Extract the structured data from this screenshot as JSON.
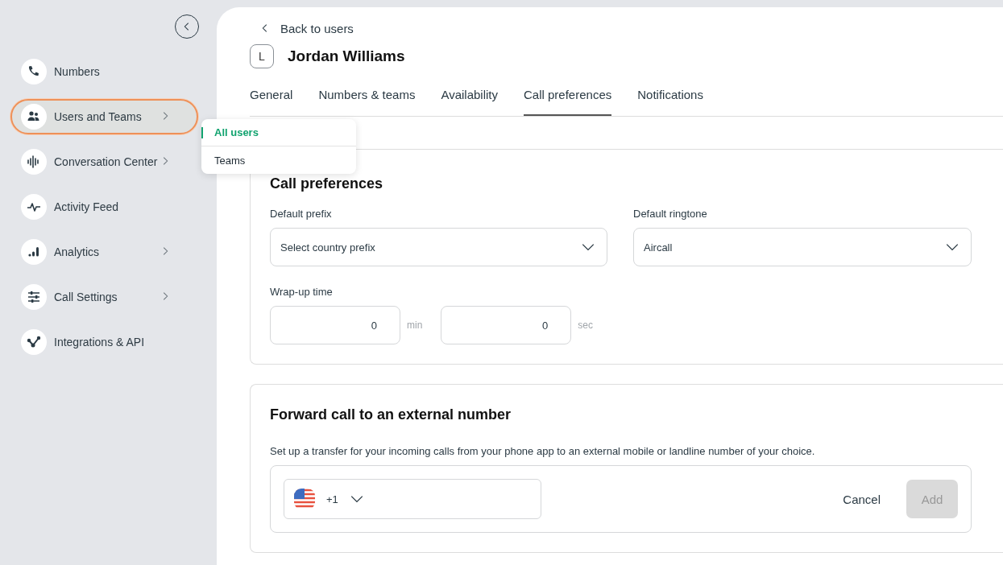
{
  "sidebar": {
    "items": [
      {
        "label": "Numbers",
        "expandable": false,
        "selected": false
      },
      {
        "label": "Users and Teams",
        "expandable": true,
        "selected": true
      },
      {
        "label": "Conversation Center",
        "expandable": true,
        "selected": false
      },
      {
        "label": "Activity Feed",
        "expandable": false,
        "selected": false
      },
      {
        "label": "Analytics",
        "expandable": true,
        "selected": false
      },
      {
        "label": "Call Settings",
        "expandable": true,
        "selected": false
      },
      {
        "label": "Integrations & API",
        "expandable": false,
        "selected": false
      }
    ],
    "submenu": [
      {
        "label": "All users",
        "selected": true
      },
      {
        "label": "Teams",
        "selected": false
      }
    ]
  },
  "back_link": "Back to users",
  "user": {
    "initial": "L",
    "name": "Jordan Williams"
  },
  "tabs": [
    {
      "label": "General",
      "selected": false
    },
    {
      "label": "Numbers & teams",
      "selected": false
    },
    {
      "label": "Availability",
      "selected": false
    },
    {
      "label": "Call preferences",
      "selected": true
    },
    {
      "label": "Notifications",
      "selected": false
    }
  ],
  "call_preferences": {
    "title": "Call preferences",
    "prefix": {
      "label": "Default prefix",
      "placeholder": "Select country prefix"
    },
    "ringtone": {
      "label": "Default ringtone",
      "value": "Aircall"
    },
    "wrap_up": {
      "label": "Wrap-up time",
      "minutes": "0",
      "minutes_unit": "min",
      "seconds": "0",
      "seconds_unit": "sec"
    }
  },
  "forward": {
    "title": "Forward call to an external number",
    "description": "Set up a transfer for your incoming calls from your phone app to an external mobile or landline number of your choice.",
    "country_code": "+1",
    "cancel": "Cancel",
    "add": "Add",
    "add_disabled": true
  }
}
